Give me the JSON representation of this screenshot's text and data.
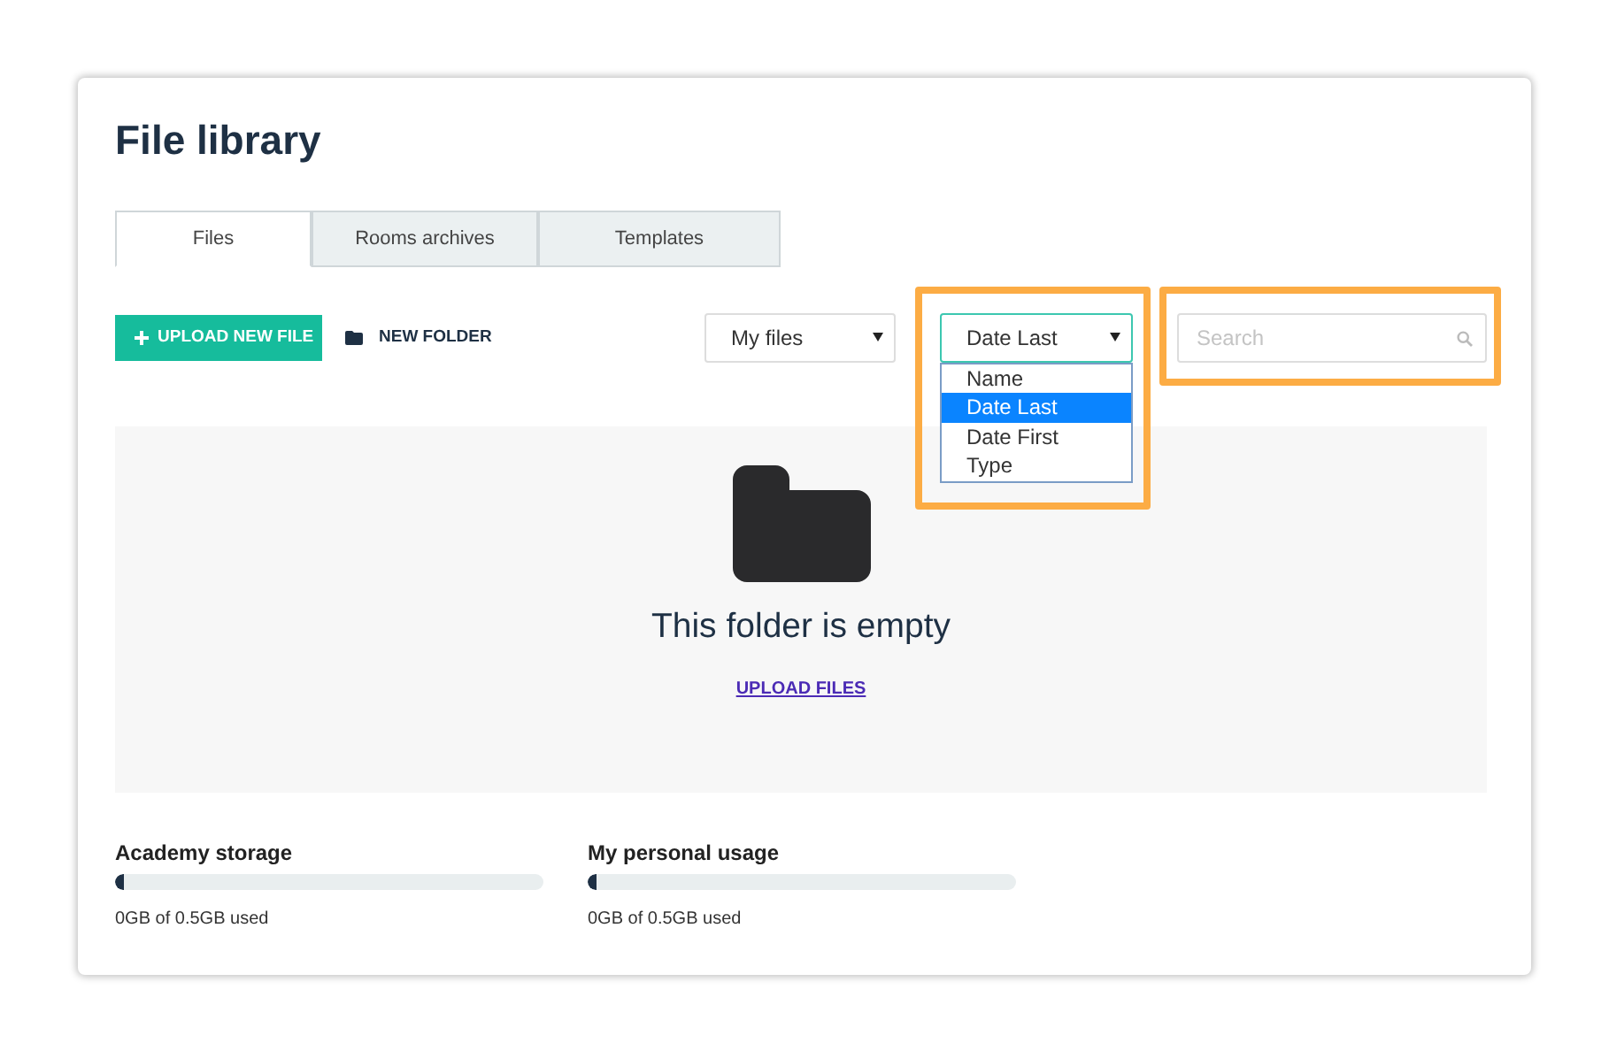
{
  "title": "File library",
  "tabs": [
    {
      "label": "Files",
      "selected": true
    },
    {
      "label": "Rooms archives",
      "selected": false
    },
    {
      "label": "Templates",
      "selected": false
    }
  ],
  "toolbar": {
    "upload_button": "UPLOAD NEW FILE",
    "new_folder_button": "NEW FOLDER",
    "filter_select": "My files",
    "sort_select": {
      "value": "Date Last",
      "expanded": true,
      "options": [
        {
          "label": "Name",
          "selected": false
        },
        {
          "label": "Date Last",
          "selected": true
        },
        {
          "label": "Date First",
          "selected": false
        },
        {
          "label": "Type",
          "selected": false
        }
      ]
    },
    "search": {
      "placeholder": "Search"
    }
  },
  "empty_state": {
    "message": "This folder is empty",
    "link": "UPLOAD FILES"
  },
  "storage": [
    {
      "label": "Academy storage",
      "level": 0.02,
      "reading": "0GB of 0.5GB used"
    },
    {
      "label": "My personal usage",
      "level": 0.02,
      "reading": "0GB of 0.5GB used"
    }
  ]
}
